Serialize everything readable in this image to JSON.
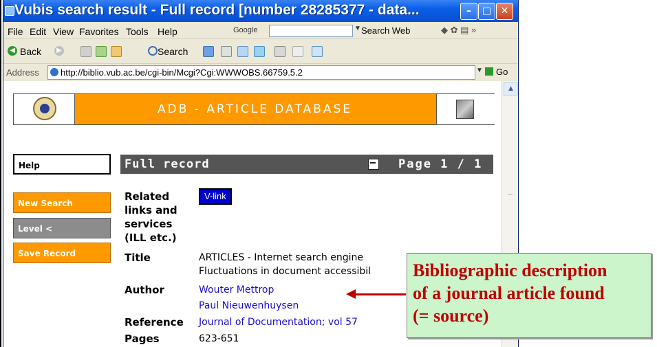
{
  "window": {
    "title": "Vubis search result - Full record [number 28285377 - data..."
  },
  "menubar": {
    "items": [
      "File",
      "Edit",
      "View",
      "Favorites",
      "Tools",
      "Help"
    ],
    "google_label": "Google",
    "search_web_label": "Search Web"
  },
  "toolbar": {
    "back_label": "Back",
    "search_label": "Search"
  },
  "address": {
    "label": "Address",
    "url": "http://biblio.vub.ac.be/cgi-bin/Mcgi?Cgi:WWWOBS.66759.5.2",
    "go_label": "Go"
  },
  "header": {
    "title": "ADB - ARTICLE DATABASE"
  },
  "sidebar": {
    "help": "Help",
    "new_search": "New Search",
    "level": "Level <",
    "save_record": "Save Record"
  },
  "record": {
    "bar_title": "Full record",
    "page_label": "Page 1 / 1",
    "related_label_lines": [
      "Related",
      "links and",
      "services",
      "(ILL etc.)"
    ],
    "vlink": "V-link",
    "title_label": "Title",
    "title_lines": [
      "ARTICLES - Internet search engine",
      "Fluctuations in document accessibil"
    ],
    "author_label": "Author",
    "authors": [
      "Wouter Mettrop",
      "Paul Nieuwenhuysen"
    ],
    "reference_label": "Reference",
    "reference": "Journal of Documentation; vol 57",
    "pages_label": "Pages",
    "pages": "623-651"
  },
  "callout": {
    "lines": [
      "Bibliographic description",
      "of a journal article found",
      "(= source)"
    ]
  },
  "colors": {
    "accent_orange": "#ff9900",
    "callout_bg": "#ccf5cc",
    "callout_text": "#c00000",
    "link_blue": "#1a0dcc"
  }
}
